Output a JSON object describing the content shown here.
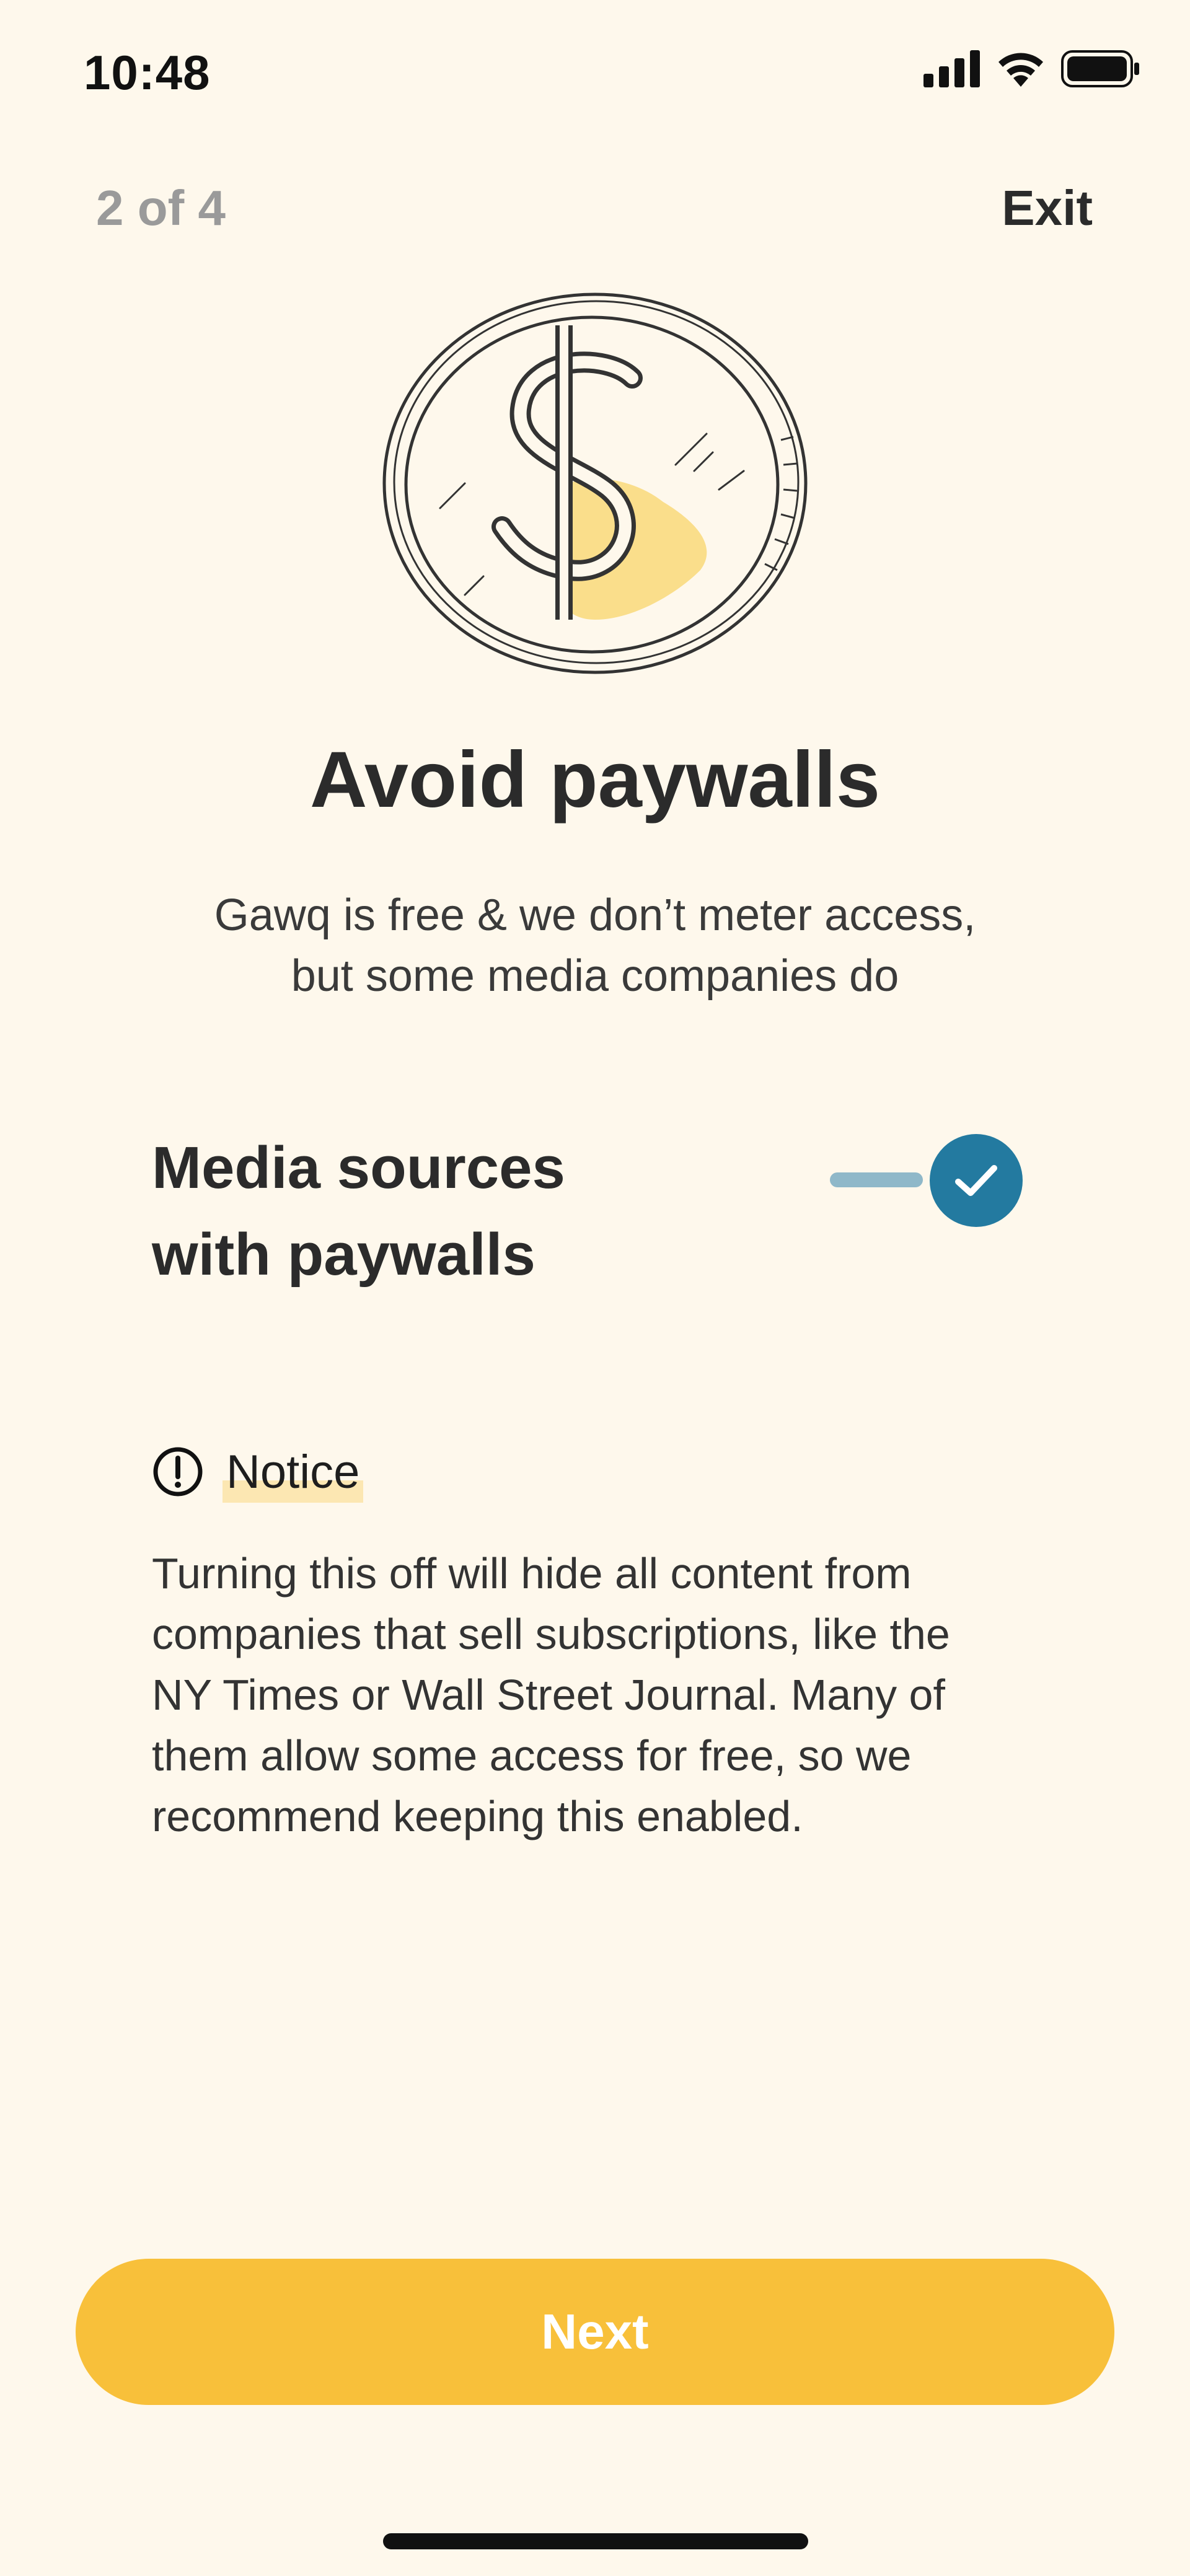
{
  "status_bar": {
    "time": "10:48",
    "icons": [
      "cellular-signal-icon",
      "wifi-icon",
      "battery-icon"
    ]
  },
  "nav": {
    "progress": "2 of 4",
    "exit_label": "Exit"
  },
  "illustration": {
    "icon": "dollar-coin-icon"
  },
  "content": {
    "title": "Avoid paywalls",
    "subtitle_line1": "Gawq is free & we don’t meter access,",
    "subtitle_line2": "but some media companies do"
  },
  "option": {
    "label_line1": "Media sources",
    "label_line2": "with paywalls",
    "enabled": true
  },
  "notice": {
    "icon": "exclamation-circle-icon",
    "title": "Notice",
    "body_lines": [
      "Turning this off will hide all content from",
      "companies that sell subscriptions, like the",
      "NY Times or Wall Street Journal. Many of",
      "them allow some access for free, so we",
      "recommend keeping this enabled."
    ]
  },
  "footer": {
    "next_label": "Next"
  },
  "colors": {
    "background": "#FEF8EC",
    "accent_yellow": "#F8C03A",
    "toggle_blue": "#237AA0",
    "toggle_track": "#8FB8C9",
    "highlight": "#FCE7B2",
    "muted_text": "#9A9A9A"
  }
}
